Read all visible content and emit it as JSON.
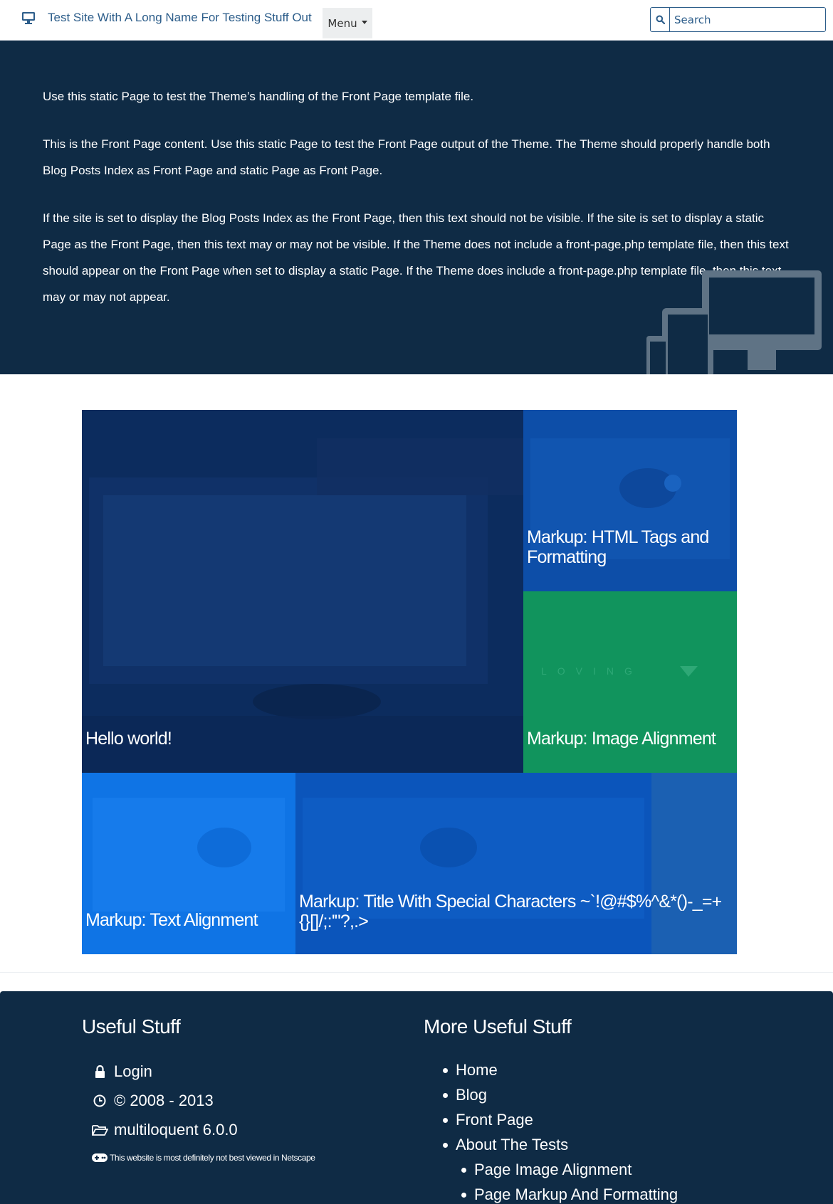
{
  "navbar": {
    "brand": "Test Site With A Long Name For Testing Stuff Out",
    "menu_label": "Menu",
    "search_placeholder": "Search",
    "colors": {
      "brand": "#2c5d8a",
      "background": "#ffffff"
    }
  },
  "hero": {
    "paragraphs": [
      "Use this static Page to test the Theme’s handling of the Front Page template file.",
      "This is the Front Page content. Use this static Page to test the Front Page output of the Theme. The Theme should properly handle both Blog Posts Index as Front Page and static Page as Front Page.",
      "If the site is set to display the Blog Posts Index as the Front Page, then this text should not be visible. If the site is set to display a static Page as the Front Page, then this text may or may not be visible. If the Theme does not include a front-page.php template file, then this text should appear on the Front Page when set to display a static Page. If the Theme does include a front-page.php template file, then this text may or may not appear."
    ],
    "background": "#0f2b45"
  },
  "tiles": [
    {
      "title": "Hello world!",
      "color": "#0c2c5e"
    },
    {
      "title": "Markup: HTML Tags and Formatting",
      "color": "#0d4ea8"
    },
    {
      "title": "Markup: Image Alignment",
      "color": "#11945d"
    },
    {
      "title": "Markup: Text Alignment",
      "color": "#0f74e5"
    },
    {
      "title": "Markup: Title With Special Characters ~`!@#$%^&*()-_=+{}[]/;:'\"?,.>",
      "color": "#0b55bb"
    }
  ],
  "footer": {
    "col1_title": "Useful Stuff",
    "col1_items": [
      {
        "icon": "lock-icon",
        "label": "Login"
      },
      {
        "icon": "clock-icon",
        "label": "© 2008 - 2013"
      },
      {
        "icon": "folder-open-icon",
        "label": "multiloquent 6.0.0"
      }
    ],
    "netscape_note": {
      "icon": "gamepad-icon",
      "label": "This website is most definitely not best viewed in Netscape"
    },
    "col2_title": "More Useful Stuff",
    "col2_items": [
      "Home",
      "Blog",
      "Front Page",
      "About The Tests"
    ],
    "col2_subitems": [
      "Page Image Alignment",
      "Page Markup And Formatting"
    ],
    "background": "#0f2b45"
  }
}
